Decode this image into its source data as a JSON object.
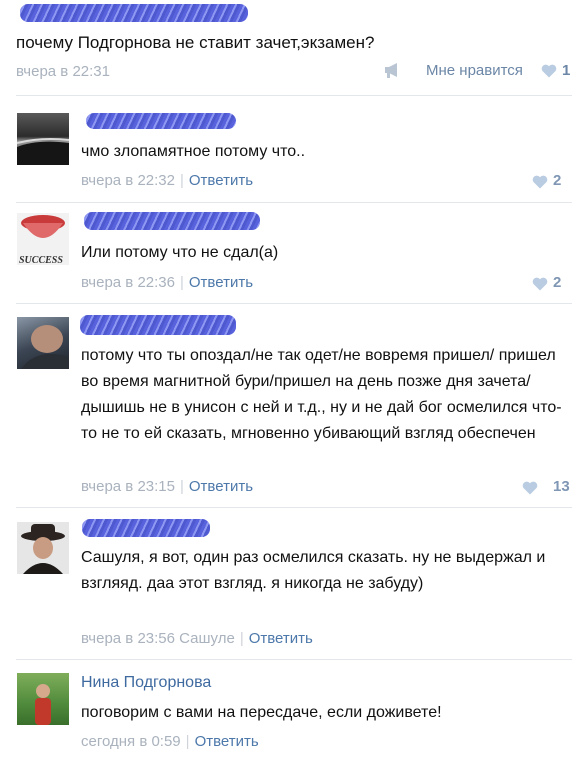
{
  "post": {
    "text": "почему Подгорнова не ставит зачет,экзамен?",
    "time": "вчера в 22:31",
    "like_label": "Мне нравится",
    "like_count": "1"
  },
  "reply_label": "Ответить",
  "comments": [
    {
      "name": "",
      "text": "чмо злопамятное потому что..",
      "time": "вчера в 22:32",
      "likes": "2"
    },
    {
      "name": "",
      "text": "Или потому что не сдал(а)",
      "time": "вчера в 22:36",
      "likes": "2",
      "avatar_caption": "SUCCESS"
    },
    {
      "name": "",
      "text": "потому что ты опоздал/не так одет/не вовремя пришел/ пришел во время магнитной бури/пришел на день позже дня зачета/ дышишь не в унисон с ней и т.д., ну и не дай бог осмелился что-то не то ей сказать, мгновенно убивающий взгляд обеспечен",
      "time": "вчера в 23:15",
      "likes": "13"
    },
    {
      "name": "",
      "text": "Сашуля, я вот, один раз осмелился сказать. ну не выдержал и взгляяд. даа этот взгляд. я никогда не забуду)",
      "time": "вчера в 23:56",
      "reply_to": "Сашуле",
      "likes": ""
    },
    {
      "name": "Нина Подгорнова",
      "text": "поговорим с вами на пересдаче, если доживете!",
      "time": "сегодня в 0:59",
      "likes": ""
    }
  ],
  "colors": {
    "link": "#3f6aa0",
    "meta": "#a9b2bd",
    "heart": "#b9cce2",
    "scribble": "#3a46d6"
  }
}
